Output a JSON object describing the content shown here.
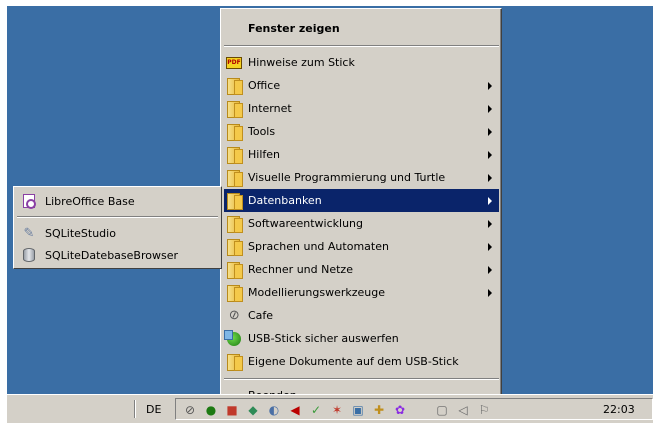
{
  "menu": {
    "header": "Fenster zeigen",
    "items": [
      {
        "label": "Hinweise zum Stick",
        "icon": "pdf-icon",
        "submenu": false
      },
      {
        "label": "Office",
        "icon": "folder-icon",
        "submenu": true
      },
      {
        "label": "Internet",
        "icon": "folder-icon",
        "submenu": true
      },
      {
        "label": "Tools",
        "icon": "folder-icon",
        "submenu": true
      },
      {
        "label": "Hilfen",
        "icon": "folder-icon",
        "submenu": true
      },
      {
        "label": "Visuelle Programmierung und Turtle",
        "icon": "folder-icon",
        "submenu": true
      },
      {
        "label": "Datenbanken",
        "icon": "folder-icon",
        "submenu": true,
        "selected": true
      },
      {
        "label": "Softwareentwicklung",
        "icon": "folder-icon",
        "submenu": true
      },
      {
        "label": "Sprachen und Automaten",
        "icon": "folder-icon",
        "submenu": true
      },
      {
        "label": "Rechner und Netze",
        "icon": "folder-icon",
        "submenu": true
      },
      {
        "label": "Modellierungswerkzeuge",
        "icon": "folder-icon",
        "submenu": true
      },
      {
        "label": "Cafe",
        "icon": "paperclip-icon",
        "submenu": false
      },
      {
        "label": "USB-Stick sicher auswerfen",
        "icon": "usb-eject-icon",
        "submenu": false
      },
      {
        "label": "Eigene Dokumente auf dem USB-Stick",
        "icon": "folder-icon",
        "submenu": false
      }
    ],
    "footer": "Beenden"
  },
  "submenu": {
    "items": [
      {
        "label": "LibreOffice Base",
        "icon": "libreoffice-base-icon"
      },
      {
        "label": "SQLiteStudio",
        "icon": "feather-icon"
      },
      {
        "label": "SQLiteDatebaseBrowser",
        "icon": "database-icon"
      }
    ]
  },
  "taskbar": {
    "language": "DE",
    "clock": "22:03"
  },
  "colors": {
    "desktop": "#3a6ea5",
    "menu_bg": "#d4d0c8",
    "selection": "#0a246a"
  }
}
